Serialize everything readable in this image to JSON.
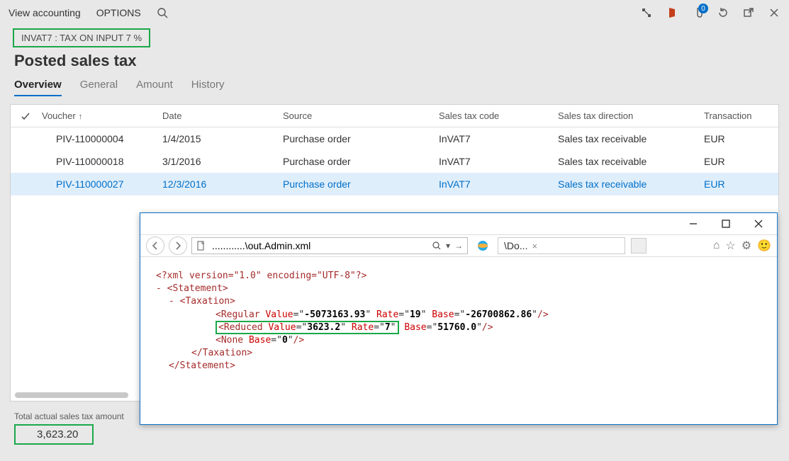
{
  "topbar": {
    "view_accounting": "View accounting",
    "options": "OPTIONS",
    "badge": "0"
  },
  "tagline": "INVAT7 : TAX ON INPUT 7 %",
  "page_title": "Posted sales tax",
  "tabs": {
    "overview": "Overview",
    "general": "General",
    "amount": "Amount",
    "history": "History"
  },
  "columns": {
    "voucher": "Voucher",
    "date": "Date",
    "source": "Source",
    "stc": "Sales tax code",
    "std": "Sales tax direction",
    "tc": "Transaction"
  },
  "rows": [
    {
      "voucher": "PIV-110000004",
      "date": "1/4/2015",
      "source": "Purchase order",
      "stc": "InVAT7",
      "std": "Sales tax receivable",
      "tc": "EUR"
    },
    {
      "voucher": "PIV-110000018",
      "date": "3/1/2016",
      "source": "Purchase order",
      "stc": "InVAT7",
      "std": "Sales tax receivable",
      "tc": "EUR"
    },
    {
      "voucher": "PIV-110000027",
      "date": "12/3/2016",
      "source": "Purchase order",
      "stc": "InVAT7",
      "std": "Sales tax receivable",
      "tc": "EUR"
    }
  ],
  "footer": {
    "label": "Total actual sales tax amount",
    "value": "3,623.20"
  },
  "ie": {
    "url": "............\\out.Admin.xml",
    "tab": "\\Do...",
    "xml_decl": "<?xml version=\"1.0\" encoding=\"UTF-8\"?>",
    "regular_value": "-5073163.93",
    "regular_rate": "19",
    "regular_base": "-26700862.86",
    "reduced_value": "3623.2",
    "reduced_rate": "7",
    "reduced_base": "51760.0",
    "none_base": "0"
  }
}
